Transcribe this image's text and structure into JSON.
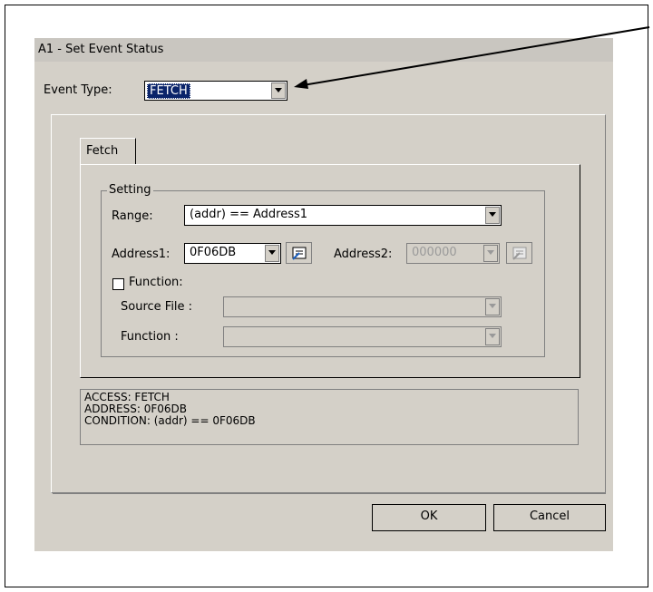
{
  "dialog": {
    "title": "A1 - Set Event Status",
    "event_type_label": "Event Type:",
    "event_type_value": "FETCH"
  },
  "tab": {
    "label": "Fetch"
  },
  "setting": {
    "group_label": "Setting",
    "range_label": "Range:",
    "range_value": "(addr) == Address1",
    "address1_label": "Address1:",
    "address1_value": "0F06DB",
    "address2_label": "Address2:",
    "address2_value": "000000",
    "function_checkbox_label": "Function:",
    "function_checked": false,
    "source_file_label": "Source File :",
    "source_file_value": "",
    "function_label": "Function :",
    "function_value": ""
  },
  "info": {
    "lines": [
      "ACCESS: FETCH",
      "ADDRESS: 0F06DB",
      "CONDITION: (addr) == 0F06DB"
    ]
  },
  "buttons": {
    "ok": "OK",
    "cancel": "Cancel"
  }
}
